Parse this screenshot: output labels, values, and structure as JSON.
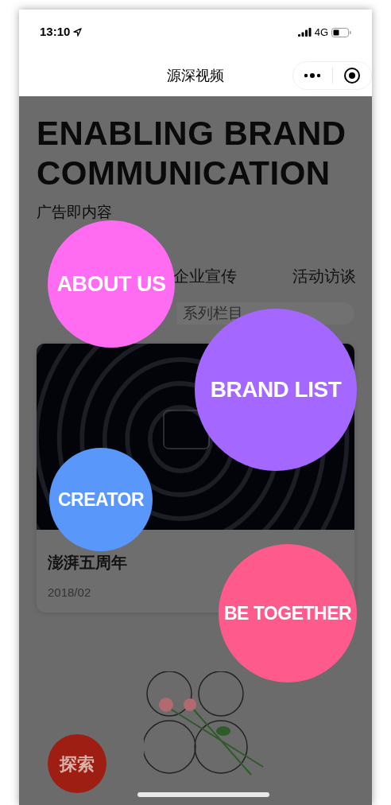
{
  "status_bar": {
    "time": "13:10",
    "network": "4G"
  },
  "nav_bar": {
    "title": "源深视频"
  },
  "hero": {
    "title": "ENABLING BRAND COMMUNICATION",
    "subtitle": "广告即内容"
  },
  "tabs": [
    {
      "label": "企业宣传"
    },
    {
      "label": "活动访谈"
    }
  ],
  "search": {
    "placeholder": "系列栏目"
  },
  "cards": [
    {
      "kind": "record",
      "title": "澎湃五周年",
      "date": "2018/02"
    },
    {
      "kind": "poster"
    }
  ],
  "explore_button": {
    "label": "探索"
  },
  "menu_bubbles": [
    {
      "label": "ABOUT US",
      "color": "#ff6cf2"
    },
    {
      "label": "BRAND LIST",
      "color": "#a467ff"
    },
    {
      "label": "CREATOR",
      "color": "#5a97fb"
    },
    {
      "label": "BE TOGETHER",
      "color": "#ff5a8c"
    }
  ]
}
